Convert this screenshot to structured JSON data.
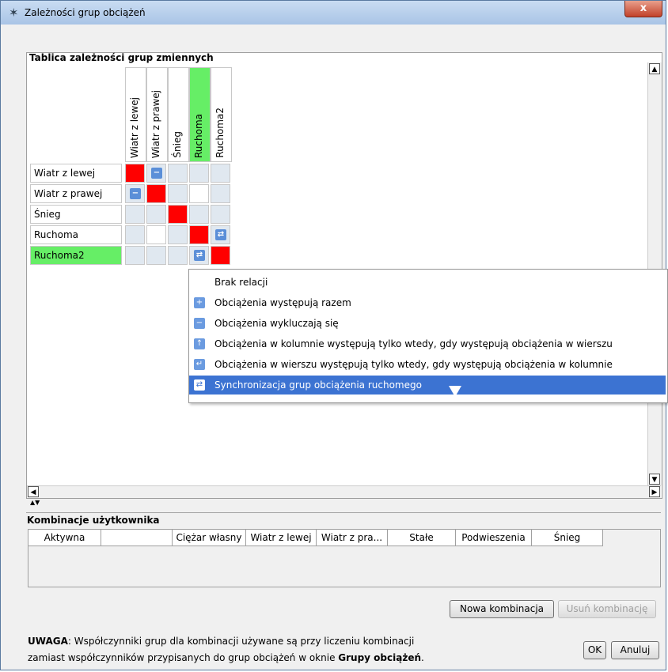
{
  "window": {
    "title": "Zależności grup obciążeń",
    "close_label": "x"
  },
  "dependency_table": {
    "title": "Tablica zależności grup zmiennych",
    "columns": [
      "Wiatr z lewej",
      "Wiatr z prawej",
      "Śnieg",
      "Ruchoma",
      "Ruchoma2"
    ],
    "rows": [
      "Wiatr z lewej",
      "Wiatr z prawej",
      "Śnieg",
      "Ruchoma",
      "Ruchoma2"
    ]
  },
  "context_menu": {
    "items": [
      {
        "label": "Brak relacji",
        "icon": "none"
      },
      {
        "label": "Obciążenia występują razem",
        "icon": "plus-icon",
        "glyph": "+"
      },
      {
        "label": "Obciążenia wykluczają się",
        "icon": "minus-icon",
        "glyph": "−"
      },
      {
        "label": "Obciążenia w kolumnie występują tylko wtedy, gdy występują obciążenia w wierszu",
        "icon": "arrow-up-icon",
        "glyph": "↑"
      },
      {
        "label": "Obciążenia w wierszu występują tylko wtedy, gdy występują obciążenia w kolumnie",
        "icon": "arrow-left-icon",
        "glyph": "↵"
      },
      {
        "label": "Synchronizacja grup obciążenia ruchomego",
        "icon": "sync-icon",
        "glyph": "⇄"
      }
    ]
  },
  "user_combinations": {
    "title": "Kombinacje użytkownika",
    "headers": [
      "Aktywna",
      "",
      "Ciężar własny",
      "Wiatr z lewej",
      "Wiatr z pra...",
      "Stałe",
      "Podwieszenia",
      "Śnieg"
    ]
  },
  "buttons": {
    "new_combination": "Nowa kombinacja",
    "delete_combination": "Usuń kombinację",
    "ok": "OK",
    "cancel": "Anuluj"
  },
  "note": {
    "label": "UWAGA",
    "text1": ": Współczynniki grup dla kombinacji używane są przy liczeniu kombinacji",
    "text2": "zamiast współczynników przypisanych do grup obciążeń w oknie ",
    "text2_bold": "Grupy obciążeń",
    "text2_end": "."
  },
  "colors": {
    "highlight_green": "#66ee66",
    "diag_red": "#ff0000",
    "menu_selected": "#3c73d2"
  }
}
